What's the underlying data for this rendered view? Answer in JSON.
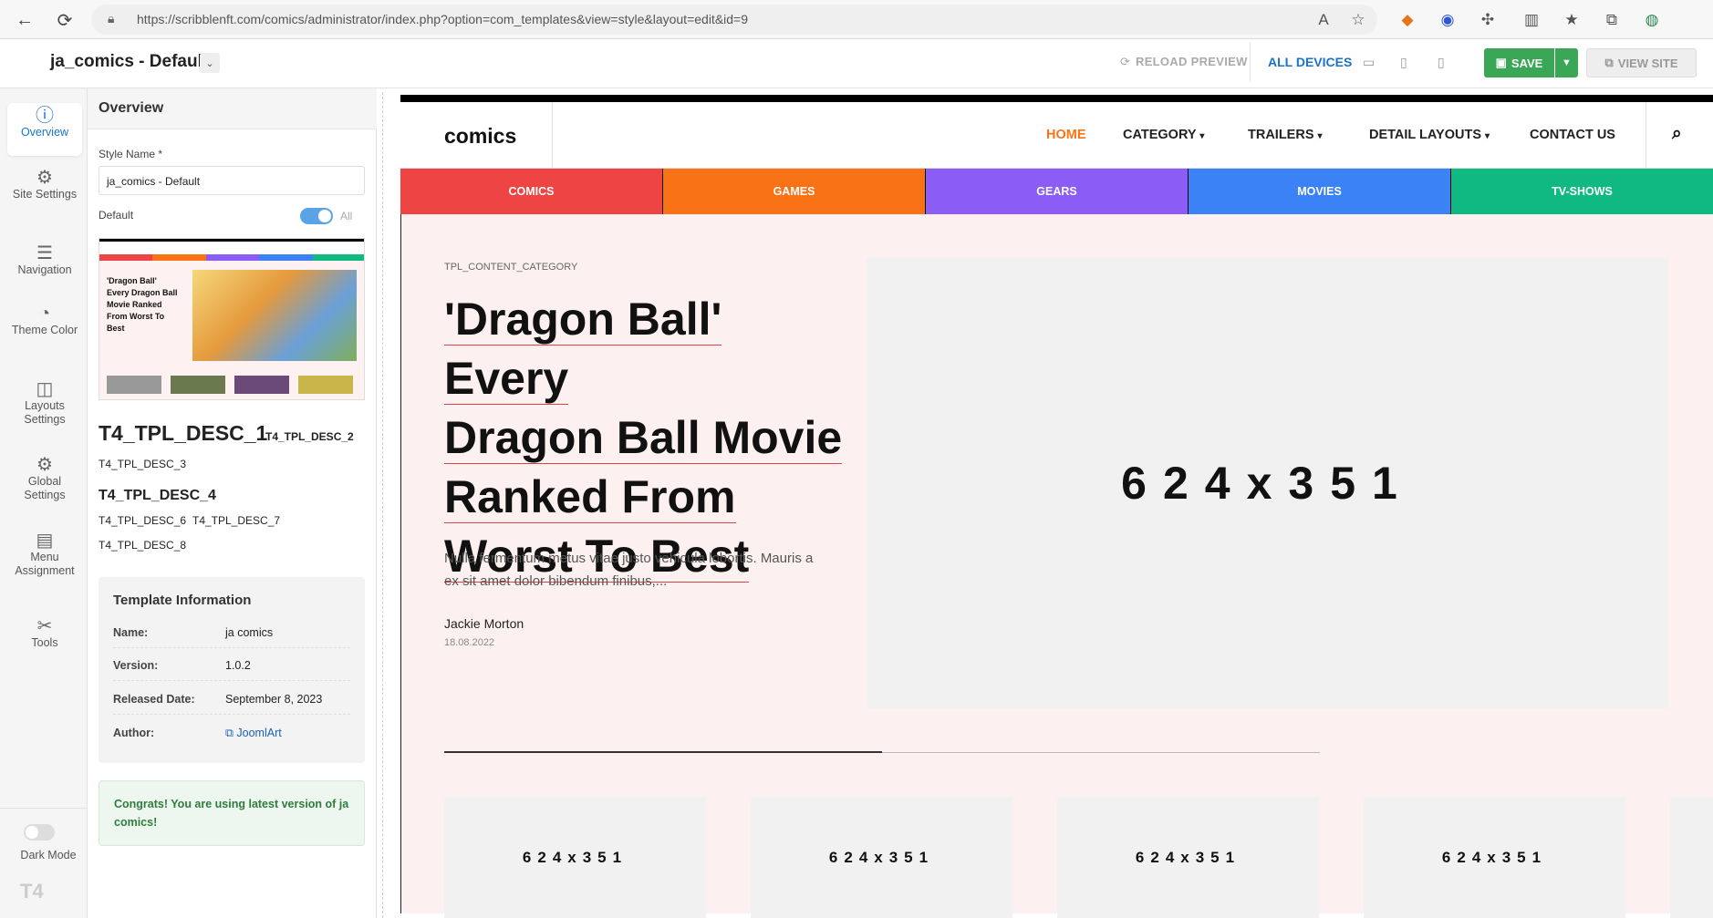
{
  "browser": {
    "url": "https://scribblenft.com/comics/administrator/index.php?option=com_templates&view=style&layout=edit&id=9"
  },
  "admin": {
    "style_title": "ja_comics - Default",
    "reload_preview": "RELOAD PREVIEW",
    "all_devices": "ALL DEVICES",
    "save": "SAVE",
    "view_site": "VIEW SITE"
  },
  "rail": {
    "items": [
      {
        "label": "Overview",
        "icon": "info-icon"
      },
      {
        "label": "Site Settings",
        "icon": "gear-icon"
      },
      {
        "label": "Navigation",
        "icon": "menu-icon"
      },
      {
        "label": "Theme Color",
        "icon": "palette-icon"
      },
      {
        "label": "Layouts Settings",
        "icon": "layout-icon"
      },
      {
        "label": "Global Settings",
        "icon": "gears-icon"
      },
      {
        "label": "Menu Assignment",
        "icon": "list-icon"
      },
      {
        "label": "Tools",
        "icon": "tools-icon"
      }
    ],
    "dark_mode": "Dark Mode",
    "logo": "T4"
  },
  "panel": {
    "title": "Overview",
    "style_name_label": "Style Name *",
    "style_name_value": "ja_comics - Default",
    "default_label": "Default",
    "default_all": "All",
    "desc1": "T4_TPL_DESC_1",
    "desc2": "T4_TPL_DESC_2",
    "desc3": "T4_TPL_DESC_3",
    "desc4": "T4_TPL_DESC_4",
    "desc6": "T4_TPL_DESC_6",
    "desc7": "T4_TPL_DESC_7",
    "desc8": "T4_TPL_DESC_8",
    "thumb_headline": "'Dragon Ball' Every Dragon Ball Movie Ranked From Worst To Best",
    "info": {
      "title": "Template Information",
      "name_k": "Name:",
      "name_v": "ja comics",
      "version_k": "Version:",
      "version_v": "1.0.2",
      "released_k": "Released Date:",
      "released_v": "September 8, 2023",
      "author_k": "Author:",
      "author_v": "JoomlArt"
    },
    "congrats": "Congrats! You are using latest version of ja comics!"
  },
  "site": {
    "logo": "comics",
    "nav": [
      "HOME",
      "CATEGORY",
      "TRAILERS",
      "DETAIL LAYOUTS",
      "CONTACT US"
    ],
    "categories": [
      {
        "label": "COMICS",
        "color": "#ef4444"
      },
      {
        "label": "GAMES",
        "color": "#f97316"
      },
      {
        "label": "GEARS",
        "color": "#8b5cf6"
      },
      {
        "label": "MOVIES",
        "color": "#3b82f6"
      },
      {
        "label": "TV-SHOWS",
        "color": "#10b981"
      }
    ],
    "content_category": "TPL_CONTENT_CATEGORY",
    "headline": [
      "'Dragon Ball' Every",
      "Dragon Ball Movie",
      "Ranked From",
      "Worst To Best"
    ],
    "excerpt": "Nulla fermentum metus vitae justo vehicula lobortis. Mauris a ex sit amet dolor bibendum finibus,...",
    "author": "Jackie Morton",
    "date": "18.08.2022",
    "image_placeholder": "624x351",
    "accent": "#f97316"
  }
}
